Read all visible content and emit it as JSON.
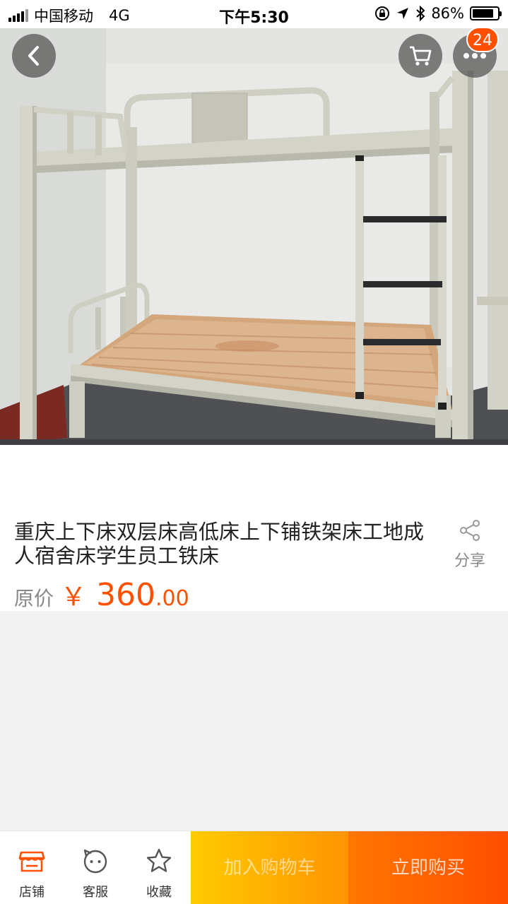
{
  "status_bar": {
    "carrier": "中国移动",
    "network": "4G",
    "time": "下午5:30",
    "battery": "86%",
    "battery_level": 0.86
  },
  "header": {
    "cart_badge": "24"
  },
  "product": {
    "title": "重庆上下床双层床高低床上下铺铁架床工地成人宿舍床学生员工铁床",
    "share_label": "分享",
    "price_label": "原价",
    "currency": "￥",
    "price_int": "360",
    "price_dec": ".00"
  },
  "bottom_bar": {
    "tabs": [
      {
        "label": "店铺",
        "icon": "store-icon"
      },
      {
        "label": "客服",
        "icon": "customer-service-icon"
      },
      {
        "label": "收藏",
        "icon": "star-icon"
      }
    ],
    "add_to_cart": "加入购物车",
    "buy_now": "立即购买"
  },
  "colors": {
    "accent": "#ff5000",
    "add_cart_gradient": [
      "#ffcb00",
      "#ff9402"
    ],
    "buy_gradient": [
      "#ff7700",
      "#ff4e00"
    ]
  }
}
